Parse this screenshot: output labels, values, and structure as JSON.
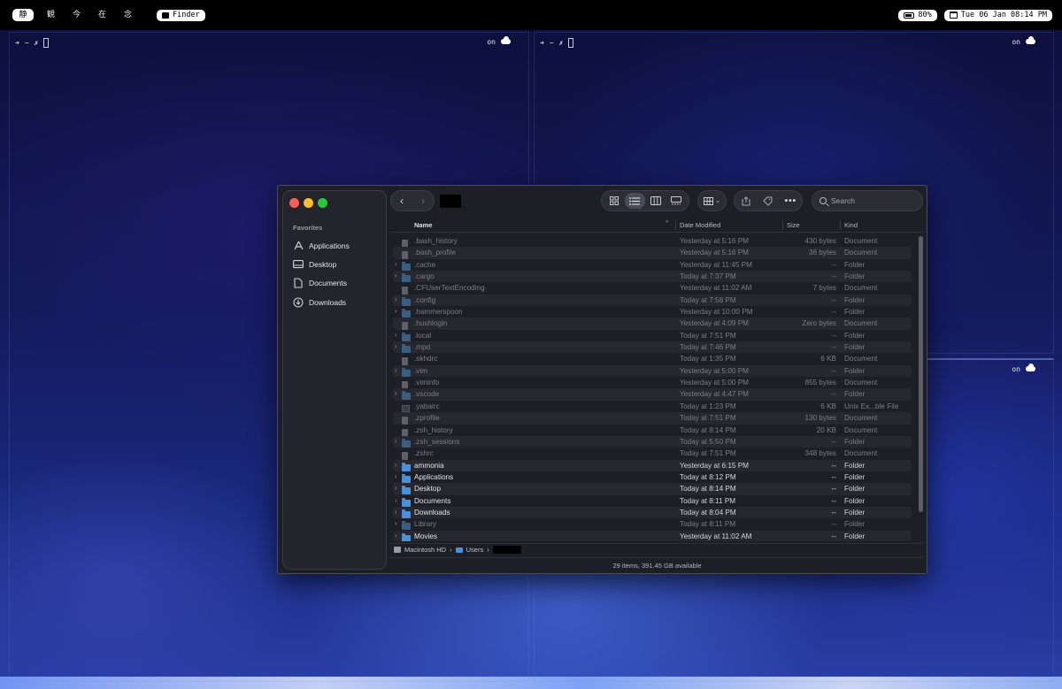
{
  "menubar": {
    "spaces": [
      "静",
      "観",
      "今",
      "在",
      "念"
    ],
    "active_app": "Finder",
    "battery": "80%",
    "datetime": "Tue 06 Jan 08:14 PM"
  },
  "terminal": {
    "prompt_arrow": "➜",
    "prompt_dir": "~",
    "prompt_mark": "✗",
    "status_text": "on"
  },
  "finder": {
    "sidebar": {
      "header": "Favorites",
      "items": [
        {
          "label": "Applications",
          "icon": "applications-icon"
        },
        {
          "label": "Desktop",
          "icon": "desktop-icon"
        },
        {
          "label": "Documents",
          "icon": "document-icon"
        },
        {
          "label": "Downloads",
          "icon": "downloads-icon"
        }
      ]
    },
    "search": {
      "placeholder": "Search"
    },
    "columns": {
      "name": "Name",
      "date": "Date Modified",
      "size": "Size",
      "kind": "Kind"
    },
    "rows": [
      {
        "name": ".bash_history",
        "date": "Yesterday at 5:16 PM",
        "size": "430 bytes",
        "kind": "Document",
        "type": "doc",
        "hidden": true
      },
      {
        "name": ".bash_profile",
        "date": "Yesterday at 5:16 PM",
        "size": "36 bytes",
        "kind": "Document",
        "type": "doc",
        "hidden": true
      },
      {
        "name": ".cache",
        "date": "Yesterday at 11:45 PM",
        "size": "--",
        "kind": "Folder",
        "type": "folder",
        "hidden": true
      },
      {
        "name": ".cargo",
        "date": "Today at 7:37 PM",
        "size": "--",
        "kind": "Folder",
        "type": "folder",
        "hidden": true
      },
      {
        "name": ".CFUserTextEncoding",
        "date": "Yesterday at 11:02 AM",
        "size": "7 bytes",
        "kind": "Document",
        "type": "doc",
        "hidden": true
      },
      {
        "name": ".config",
        "date": "Today at 7:58 PM",
        "size": "--",
        "kind": "Folder",
        "type": "folder",
        "hidden": true
      },
      {
        "name": ".hammerspoon",
        "date": "Yesterday at 10:00 PM",
        "size": "--",
        "kind": "Folder",
        "type": "folder",
        "hidden": true
      },
      {
        "name": ".hushlogin",
        "date": "Yesterday at 4:09 PM",
        "size": "Zero bytes",
        "kind": "Document",
        "type": "doc",
        "hidden": true
      },
      {
        "name": ".local",
        "date": "Today at 7:51 PM",
        "size": "--",
        "kind": "Folder",
        "type": "folder",
        "hidden": true
      },
      {
        "name": ".mpd",
        "date": "Today at 7:46 PM",
        "size": "--",
        "kind": "Folder",
        "type": "folder",
        "hidden": true
      },
      {
        "name": ".skhdrc",
        "date": "Today at 1:35 PM",
        "size": "6 KB",
        "kind": "Document",
        "type": "doc",
        "hidden": true
      },
      {
        "name": ".vim",
        "date": "Yesterday at 5:00 PM",
        "size": "--",
        "kind": "Folder",
        "type": "folder",
        "hidden": true
      },
      {
        "name": ".viminfo",
        "date": "Yesterday at 5:00 PM",
        "size": "855 bytes",
        "kind": "Document",
        "type": "doc",
        "hidden": true
      },
      {
        "name": ".vscode",
        "date": "Yesterday at 4:47 PM",
        "size": "--",
        "kind": "Folder",
        "type": "folder",
        "hidden": true
      },
      {
        "name": ".yabairc",
        "date": "Today at 1:23 PM",
        "size": "6 KB",
        "kind": "Unix Ex...ble File",
        "type": "exec",
        "hidden": true
      },
      {
        "name": ".zprofile",
        "date": "Today at 7:51 PM",
        "size": "130 bytes",
        "kind": "Document",
        "type": "doc",
        "hidden": true
      },
      {
        "name": ".zsh_history",
        "date": "Today at 8:14 PM",
        "size": "20 KB",
        "kind": "Document",
        "type": "doc",
        "hidden": true
      },
      {
        "name": ".zsh_sessions",
        "date": "Today at 5:50 PM",
        "size": "--",
        "kind": "Folder",
        "type": "folder",
        "hidden": true
      },
      {
        "name": ".zshrc",
        "date": "Today at 7:51 PM",
        "size": "348 bytes",
        "kind": "Document",
        "type": "doc",
        "hidden": true
      },
      {
        "name": "ammonia",
        "date": "Yesterday at 6:15 PM",
        "size": "--",
        "kind": "Folder",
        "type": "folder",
        "hidden": false
      },
      {
        "name": "Applications",
        "date": "Today at 8:12 PM",
        "size": "--",
        "kind": "Folder",
        "type": "folder",
        "hidden": false
      },
      {
        "name": "Desktop",
        "date": "Today at 8:14 PM",
        "size": "--",
        "kind": "Folder",
        "type": "folder",
        "hidden": false
      },
      {
        "name": "Documents",
        "date": "Today at 8:11 PM",
        "size": "--",
        "kind": "Folder",
        "type": "folder",
        "hidden": false
      },
      {
        "name": "Downloads",
        "date": "Today at 8:04 PM",
        "size": "--",
        "kind": "Folder",
        "type": "folder",
        "hidden": false
      },
      {
        "name": "Library",
        "date": "Today at 8:11 PM",
        "size": "--",
        "kind": "Folder",
        "type": "folder",
        "hidden": true
      },
      {
        "name": "Movies",
        "date": "Yesterday at 11:02 AM",
        "size": "--",
        "kind": "Folder",
        "type": "folder",
        "hidden": false
      }
    ],
    "path": {
      "disk": "Macintosh HD",
      "users": "Users"
    },
    "status": "29 items, 391.45 GB available"
  }
}
